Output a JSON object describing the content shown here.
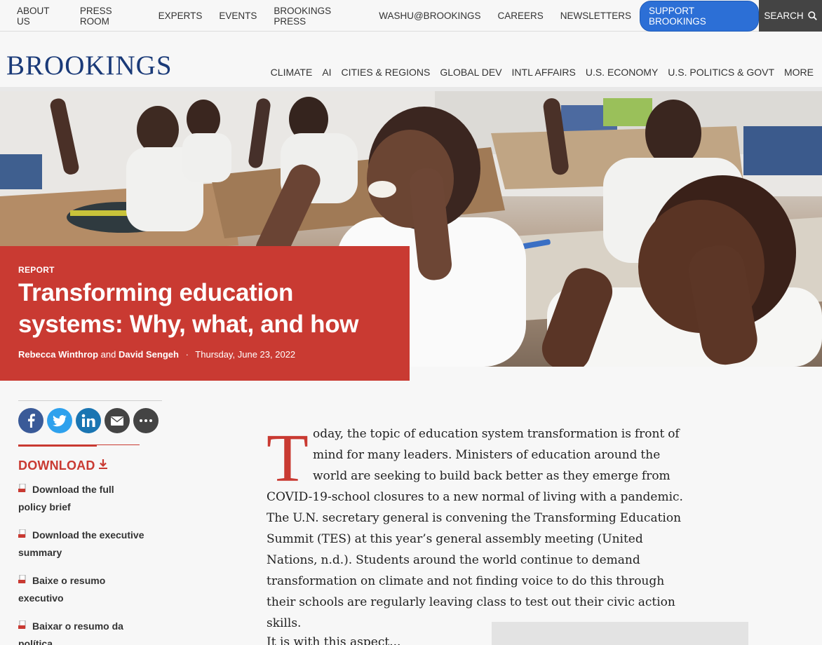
{
  "utility_nav": {
    "links": [
      "ABOUT US",
      "PRESS ROOM",
      "EXPERTS",
      "EVENTS",
      "BROOKINGS PRESS",
      "WASHU@BROOKINGS",
      "CAREERS",
      "NEWSLETTERS"
    ],
    "support_label": "SUPPORT BROOKINGS",
    "search_label": "SEARCH"
  },
  "header": {
    "logo": "BROOKINGS",
    "nav": [
      "CLIMATE",
      "AI",
      "CITIES & REGIONS",
      "GLOBAL DEV",
      "INTL AFFAIRS",
      "U.S. ECONOMY",
      "U.S. POLITICS & GOVT",
      "MORE"
    ]
  },
  "hero": {
    "kicker": "REPORT",
    "title": "Transforming education systems: Why, what, and how",
    "author1": "Rebecca Winthrop",
    "and": "and",
    "author2": "David Sengeh",
    "separator": "·",
    "date": "Thursday, June 23, 2022"
  },
  "share": {
    "icons": [
      "facebook-icon",
      "twitter-icon",
      "linkedin-icon",
      "email-icon",
      "more-icon"
    ]
  },
  "download": {
    "heading": "DOWNLOAD",
    "items": [
      {
        "label": "Download the full policy brief"
      },
      {
        "label": "Download the executive summary"
      },
      {
        "label": "Baixe o resumo executivo"
      },
      {
        "label": "Baixar o resumo da política"
      }
    ]
  },
  "article": {
    "dropcap": "T",
    "para1": "oday, the topic of education system transformation is front of mind for many leaders. Ministers of education around the world are seeking to build back better as they emerge from COVID-19-school closures to a new normal of living with a pandemic. The U.N. secretary general is convening the Transforming Education Summit (TES) at this year’s general assembly meeting (United Nations, n.d.). Students around the world continue to demand transformation on climate and not finding voice to do this through their schools are regularly leaving class to test out their civic action skills.",
    "para2_start": "It is with this aspect..."
  },
  "colors": {
    "brand_red": "#c93a32",
    "brand_blue": "#1a3a78",
    "support_blue": "#2c6fd6"
  }
}
